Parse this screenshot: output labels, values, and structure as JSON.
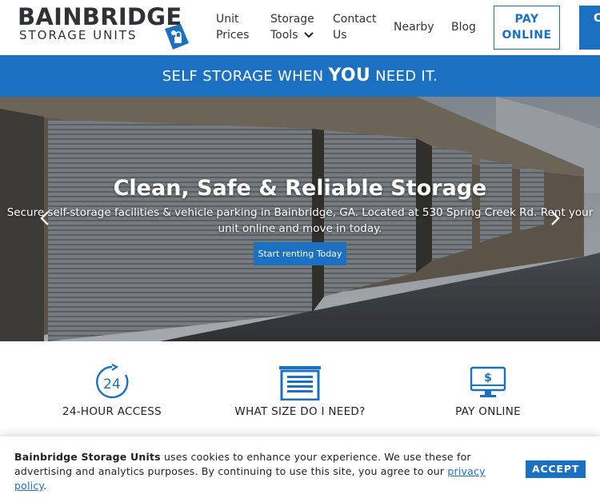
{
  "header": {
    "logo_top": "BAINBRIDGE",
    "logo_bottom": "STORAGE UNITS",
    "nav": {
      "unit_prices": "Unit Prices",
      "storage_tools": "Storage Tools",
      "contact_us": "Contact Us",
      "nearby": "Nearby",
      "blog": "Blog"
    },
    "pay_online": "PAY ONLINE",
    "cta_partial": "C U"
  },
  "banner": {
    "before": "SELF STORAGE WHEN ",
    "emphasis": "YOU",
    "after": " NEED IT."
  },
  "hero": {
    "title": "Clean, Safe & Reliable Storage",
    "subtitle": "Secure self-storage facilities & vehicle parking in Bainbridge, GA. Located at 530 Spring Creek Rd. Rent your unit online and move in today.",
    "button": "Start renting Today"
  },
  "features": [
    {
      "label": "24-HOUR ACCESS",
      "icon": "clock-24-icon",
      "icon_text": "24"
    },
    {
      "label": "WHAT SIZE DO I NEED?",
      "icon": "storage-door-icon"
    },
    {
      "label": "PAY ONLINE",
      "icon": "monitor-dollar-icon",
      "icon_text": "$"
    }
  ],
  "cookie": {
    "brand": "Bainbridge Storage Units",
    "text": " uses cookies to enhance your experience. We use these for advertising and analytics purposes. By continuing to use this site, you agree to our ",
    "link": "privacy policy",
    "end": ".",
    "accept": "ACCEPT"
  },
  "colors": {
    "brand_blue": "#1b70c2",
    "logo_dark": "#2f3236"
  }
}
